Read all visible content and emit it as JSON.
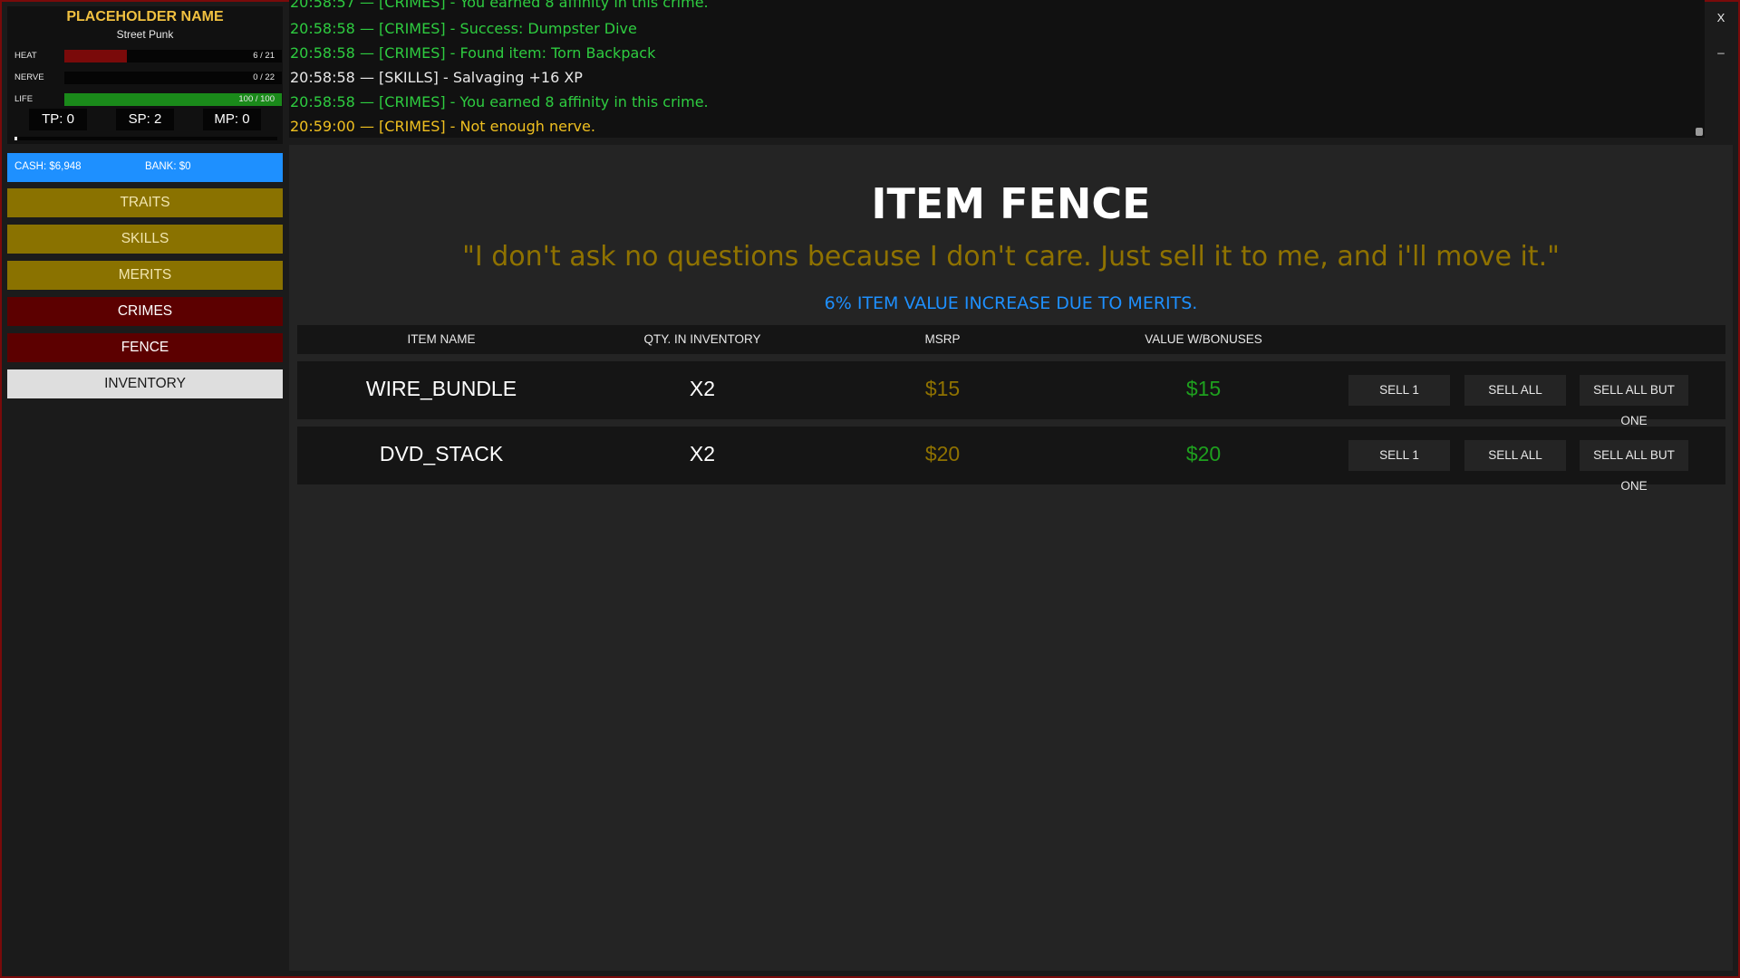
{
  "character": {
    "name": "PLACEHOLDER NAME",
    "title": "Street Punk",
    "stats": [
      {
        "label": "HEAT",
        "value": "6 / 21",
        "fraction": 0.286,
        "color": "#7a0a0a"
      },
      {
        "label": "NERVE",
        "value": "0 / 22",
        "fraction": 0.0,
        "color": "#7a0a0a"
      },
      {
        "label": "LIFE",
        "value": "100 / 100",
        "fraction": 1.0,
        "color": "#1a8a1a"
      }
    ],
    "points": {
      "tp": "TP: 0",
      "sp": "SP: 2",
      "mp": "MP: 0"
    },
    "xp_fraction": 0.01
  },
  "money": {
    "cash": "CASH: $6,948",
    "bank": "BANK: $0"
  },
  "nav": [
    {
      "label": "TRAITS",
      "style": "gold"
    },
    {
      "label": "SKILLS",
      "style": "gold"
    },
    {
      "label": "MERITS",
      "style": "gold"
    },
    {
      "label": "CRIMES",
      "style": "red"
    },
    {
      "label": "FENCE",
      "style": "red"
    },
    {
      "label": "INVENTORY",
      "style": "white"
    }
  ],
  "log": [
    {
      "text": "20:58:57 — [CRIMES] - You earned 8 affinity in this crime.",
      "color": "green"
    },
    {
      "text": "20:58:58 — [CRIMES] - Success: Dumpster Dive",
      "color": "green"
    },
    {
      "text": "20:58:58 — [CRIMES] - Found item: Torn Backpack",
      "color": "green"
    },
    {
      "text": "20:58:58 — [SKILLS] - Salvaging +16 XP",
      "color": "white"
    },
    {
      "text": "20:58:58 — [CRIMES] - You earned 8 affinity in this crime.",
      "color": "green"
    },
    {
      "text": "20:59:00 — [CRIMES] - Not enough nerve.",
      "color": "yellow"
    }
  ],
  "window": {
    "close": "X",
    "minimize": "_"
  },
  "fence": {
    "title": "ITEM FENCE",
    "quote": "\"I don't ask no questions because I don't care. Just sell it to me, and i'll move it.\"",
    "merits_note": "6% ITEM VALUE INCREASE DUE TO MERITS.",
    "columns": [
      "ITEM NAME",
      "QTY. IN INVENTORY",
      "MSRP",
      "VALUE W/BONUSES"
    ],
    "items": [
      {
        "name": "WIRE_BUNDLE",
        "qty": "X2",
        "msrp": "$15",
        "value": "$15"
      },
      {
        "name": "DVD_STACK",
        "qty": "X2",
        "msrp": "$20",
        "value": "$20"
      }
    ],
    "actions": {
      "sell_one": "SELL 1",
      "sell_all": "SELL ALL",
      "sell_all_but_one": "SELL ALL BUT ONE"
    }
  }
}
